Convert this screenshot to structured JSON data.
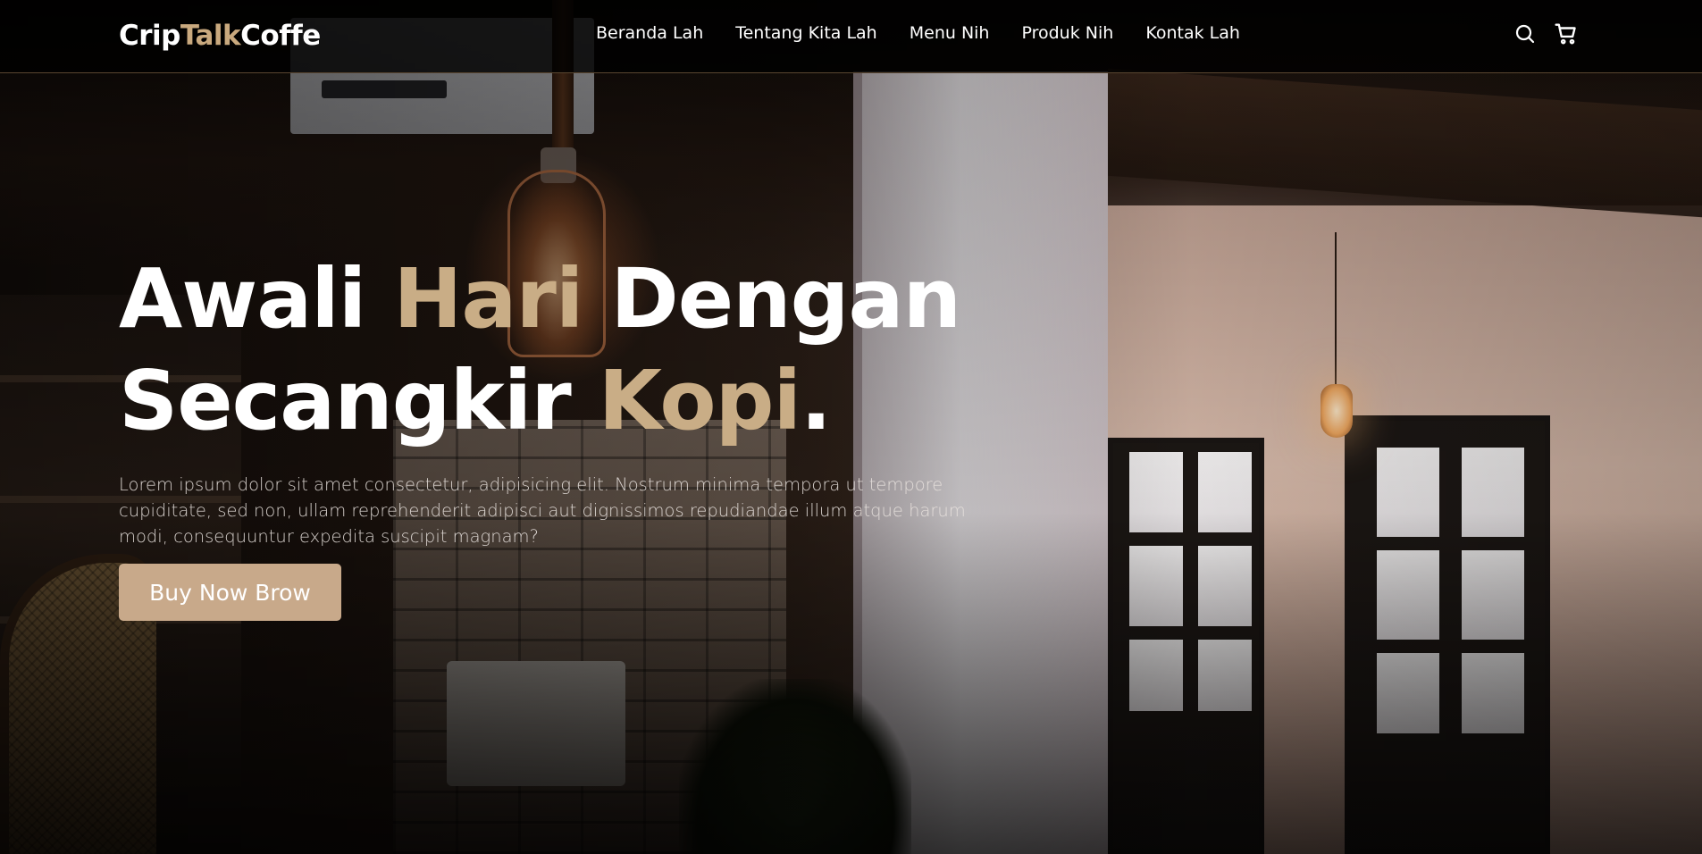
{
  "brand": {
    "logo_part1": "Crip",
    "logo_part2": "Talk",
    "logo_part3": "Coffe",
    "accent_color": "#c9a97e"
  },
  "nav": {
    "links": [
      {
        "label": "Beranda Lah"
      },
      {
        "label": "Tentang Kita Lah"
      },
      {
        "label": "Menu Nih"
      },
      {
        "label": "Produk Nih"
      },
      {
        "label": "Kontak Lah"
      }
    ],
    "icons": [
      "search-icon",
      "cart-icon"
    ]
  },
  "hero": {
    "title_line1_a": "Awali ",
    "title_line1_accent": "Hari",
    "title_line1_b": " Dengan",
    "title_line2_a": "Secangkir ",
    "title_line2_accent": "Kopi",
    "title_line2_b": ".",
    "paragraph": "Lorem ipsum dolor sit amet consectetur, adipisicing elit. Nostrum minima tempora ut tempore cupiditate, sed non, ullam reprehenderit adipisci aut dignissimos repudiandae illum atque harum modi, consequuntur expedita suscipit magnam?",
    "cta_label": "Buy Now Brow",
    "cta_color": "#c8a98a"
  }
}
